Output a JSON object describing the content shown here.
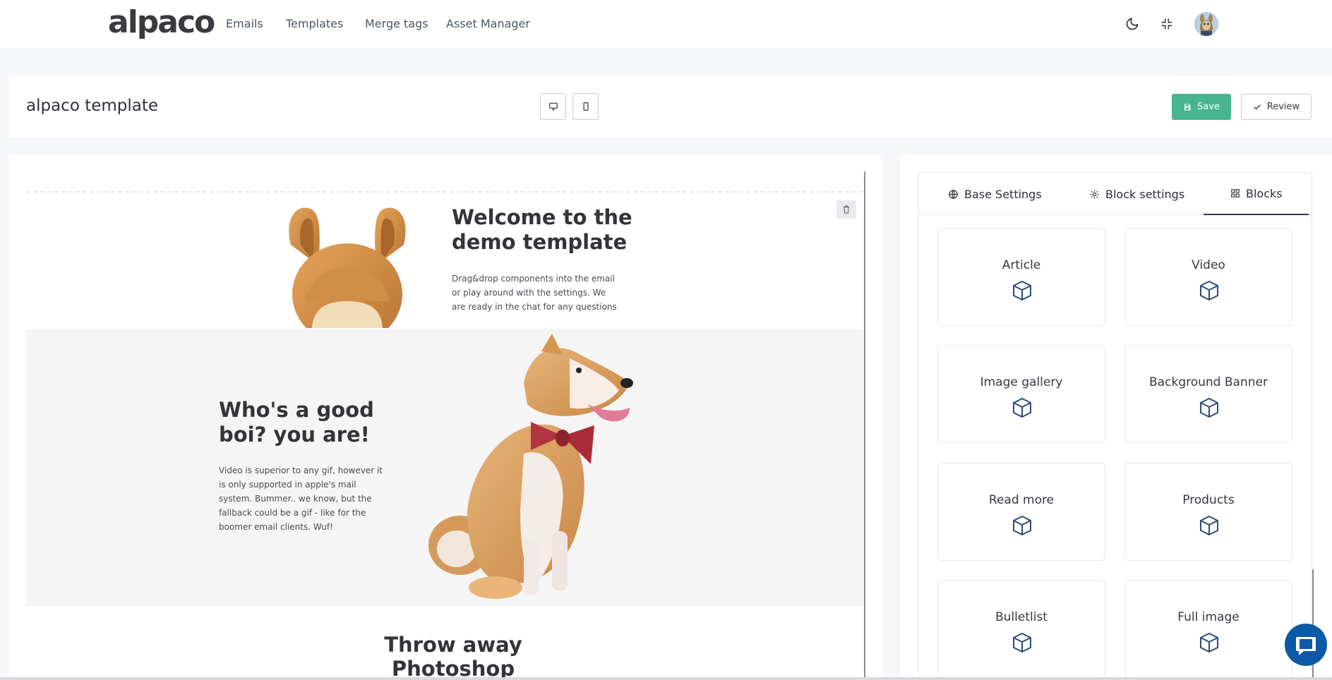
{
  "app": {
    "logo": "alpaco",
    "nav": [
      "Emails",
      "Templates",
      "Merge tags",
      "Asset Manager"
    ]
  },
  "header": {
    "template_name": "alpaco template",
    "save_label": "Save",
    "review_label": "Review"
  },
  "canvas": {
    "hero_title": "Welcome to the demo template",
    "hero_body": "Drag&drop components into the email or play around with the settings. We are ready in the chat for any questions",
    "dog_title": "Who's a good boi? you are!",
    "dog_body": "Video is superior to any gif, however it is only supported in apple's mail system. Bummer.. we know, but the fallback could be a gif - like for the boomer email clients. Wuf!",
    "photoshop_title": "Throw away Photoshop"
  },
  "panel": {
    "tabs": [
      "Base Settings",
      "Block settings",
      "Blocks"
    ],
    "active_tab": "Blocks",
    "blocks": [
      "Article",
      "Video",
      "Image gallery",
      "Background Banner",
      "Read more",
      "Products",
      "Bulletlist",
      "Full image"
    ]
  },
  "colors": {
    "accent_green": "#47b58f",
    "chat_blue": "#0c59a8",
    "block_icon": "#2d4a7a"
  }
}
